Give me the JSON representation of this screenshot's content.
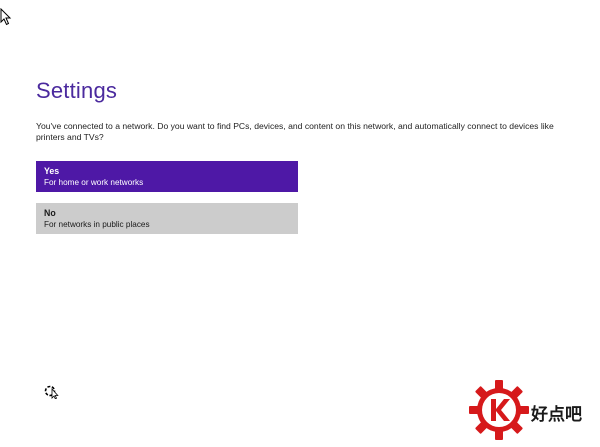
{
  "page": {
    "title": "Settings",
    "description": "You've connected to a network. Do you want to find PCs, devices, and content on this network, and automatically connect to devices like printers and TVs?"
  },
  "options": [
    {
      "title": "Yes",
      "subtitle": "For home or work networks",
      "selected": true
    },
    {
      "title": "No",
      "subtitle": "For networks in public places",
      "selected": false
    }
  ],
  "icons": {
    "pointer": "arrow-cursor-icon",
    "busy": "busy-cursor-icon",
    "watermark": "haodianba-logo"
  },
  "watermark": {
    "text": "好点吧"
  },
  "colors": {
    "accent": "#4e18a6",
    "title": "#4b2a9e",
    "option_unselected": "#cccccc",
    "logo_red": "#d6191b"
  }
}
